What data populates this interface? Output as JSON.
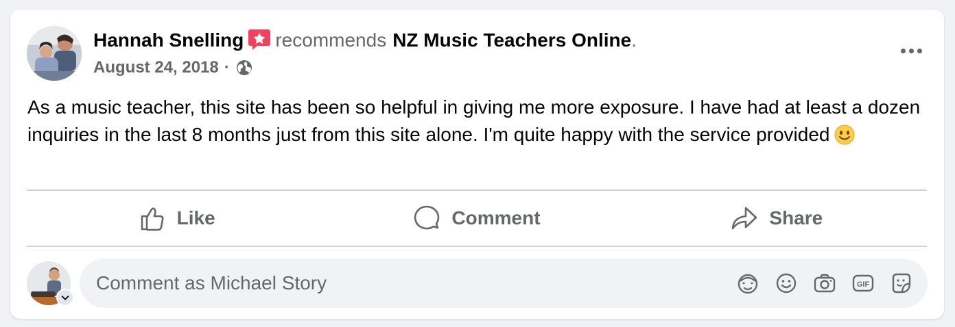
{
  "post": {
    "author": "Hannah Snelling",
    "recommends_word": "recommends",
    "page_name": "NZ Music Teachers Online",
    "period": ".",
    "date": "August 24, 2018",
    "separator": "·",
    "audience_icon": "globe-icon",
    "badge_icon": "recommend-star-badge-icon",
    "text": "As a music teacher, this site has been so helpful in giving me more exposure. I have had at least a dozen inquiries in the last 8 months just from this site alone. I'm quite happy with the service provided"
  },
  "actions": {
    "like_label": "Like",
    "comment_label": "Comment",
    "share_label": "Share"
  },
  "comment_composer": {
    "placeholder": "Comment as Michael Story",
    "tools": [
      "avatar-sticker-icon",
      "emoji-icon",
      "camera-icon",
      "gif-icon",
      "sticker-icon"
    ]
  },
  "colors": {
    "accent_badge": "#f3425f",
    "secondary_text": "#65676b",
    "card_bg": "#ffffff",
    "page_bg": "#f0f2f5"
  }
}
